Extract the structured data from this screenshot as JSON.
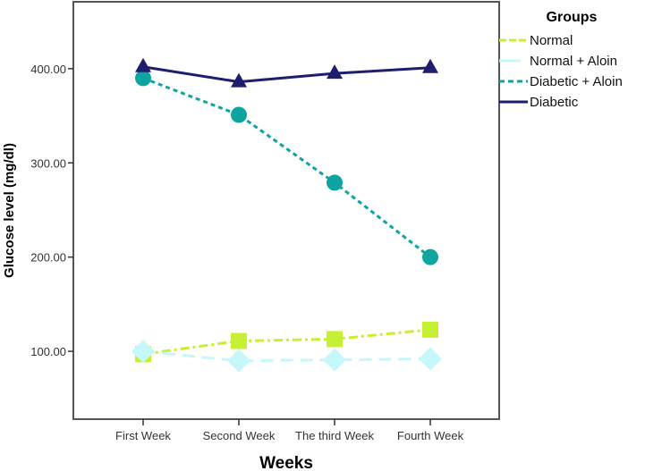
{
  "chart_data": {
    "type": "line",
    "title": "",
    "xlabel": "Weeks",
    "ylabel": "Glucose level (mg/dl)",
    "categories": [
      "First Week",
      "Second Week",
      "The third Week",
      "Fourth Week"
    ],
    "ylim": [
      28,
      471
    ],
    "yticks": [
      100,
      200,
      300,
      400
    ],
    "ytick_labels": [
      "100.00",
      "200.00",
      "300.00",
      "400.00"
    ],
    "grid": false,
    "legend": {
      "title": "Groups",
      "placement": "right-top"
    },
    "series": [
      {
        "name": "Normal",
        "color": "#c8f032",
        "marker": "square",
        "line": "dash-dot",
        "values": [
          97,
          111,
          113,
          123
        ]
      },
      {
        "name": "Normal + Aloin",
        "color": "#c6f7fb",
        "marker": "diamond",
        "line": "long-dash",
        "values": [
          100,
          90,
          91,
          92
        ]
      },
      {
        "name": "Diabetic + Aloin",
        "color": "#0ea5a0",
        "marker": "circle",
        "line": "short-dash",
        "values": [
          390,
          351,
          279,
          200
        ]
      },
      {
        "name": "Diabetic",
        "color": "#1f1d6e",
        "marker": "triangle",
        "line": "solid",
        "values": [
          402,
          386,
          395,
          401
        ]
      }
    ]
  }
}
